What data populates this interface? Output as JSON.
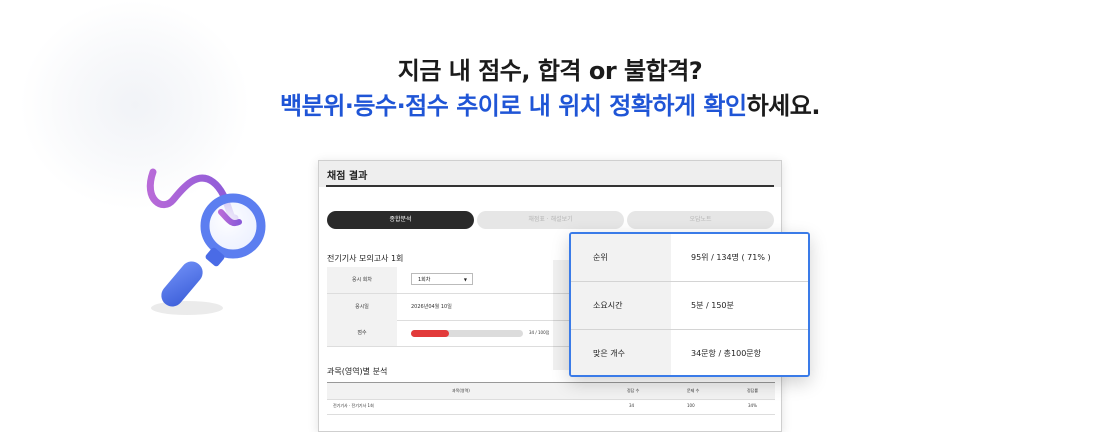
{
  "headline": {
    "line1": "지금 내 점수, 합격 or 불합격?",
    "line2_highlight": "백분위·등수·점수 추이로 내 위치 정확하게 확인",
    "line2_rest": "하세요."
  },
  "panel": {
    "title": "채점 결과",
    "tabs": [
      {
        "label": "종합분석",
        "active": true
      },
      {
        "label": "채점표 · 해설보기",
        "active": false
      },
      {
        "label": "오답노트",
        "active": false
      }
    ],
    "exam_title": "전기기사 모의고사 1회",
    "info": {
      "round_label": "응시 회차",
      "round_value": "1회차",
      "date_label": "응시일",
      "date_value": "2026년04월 10일",
      "score_label": "점수",
      "score_text": "34 / 100점",
      "score_fraction": 0.34
    },
    "subject_section_title": "과목(영역)별 분석",
    "subject_table": {
      "headers": [
        "과목(영역)",
        "정답 수",
        "문제 수",
        "정답률"
      ],
      "rows": [
        [
          "전기기사 · 전기기사 1회",
          "34",
          "100",
          "34%"
        ]
      ]
    }
  },
  "popup": {
    "rows": [
      {
        "label": "순위",
        "value": "95위 / 134명 ( 71% )"
      },
      {
        "label": "소요시간",
        "value": "5분 / 150분"
      },
      {
        "label": "맞은 개수",
        "value": "34문항 / 총100문항"
      }
    ]
  },
  "colors": {
    "accent_blue": "#1f55d6",
    "popup_border": "#3a7be8",
    "progress_red": "#e23a3a",
    "active_tab": "#2a2a2a"
  },
  "icons": [
    "magnifier-icon",
    "select-caret-icon"
  ]
}
